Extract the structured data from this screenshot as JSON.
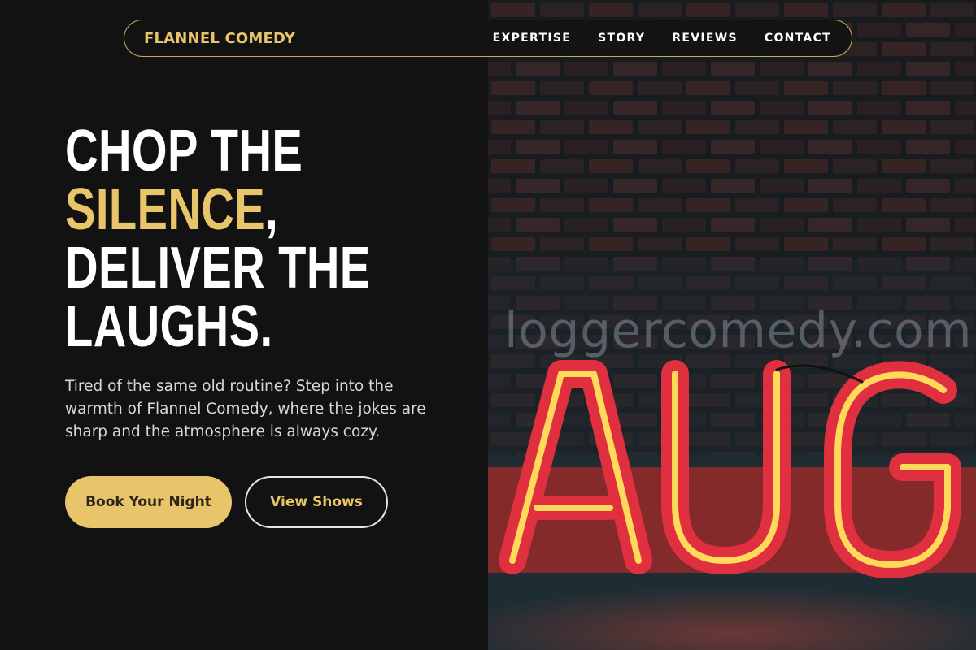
{
  "nav": {
    "brand": "FLANNEL COMEDY",
    "links": [
      "EXPERTISE",
      "STORY",
      "REVIEWS",
      "CONTACT"
    ]
  },
  "hero": {
    "headline": {
      "line1": "CHOP THE",
      "line2_accent": "SILENCE",
      "line2_rest": ",",
      "line3": "DELIVER THE",
      "line4": "LAUGHS."
    },
    "subtext": "Tired of the same old routine? Step into the warmth of Flannel Comedy, where the jokes are sharp and the atmosphere is always cozy.",
    "primary_button": "Book Your Night",
    "secondary_button": "View Shows"
  },
  "image": {
    "watermark": "loggercomedy.com",
    "neon_sign": "AUG"
  },
  "colors": {
    "background": "#121212",
    "accent": "#e8c46a",
    "text": "#ffffff",
    "neon_red": "#e0303f",
    "neon_yellow": "#ffd95a"
  }
}
